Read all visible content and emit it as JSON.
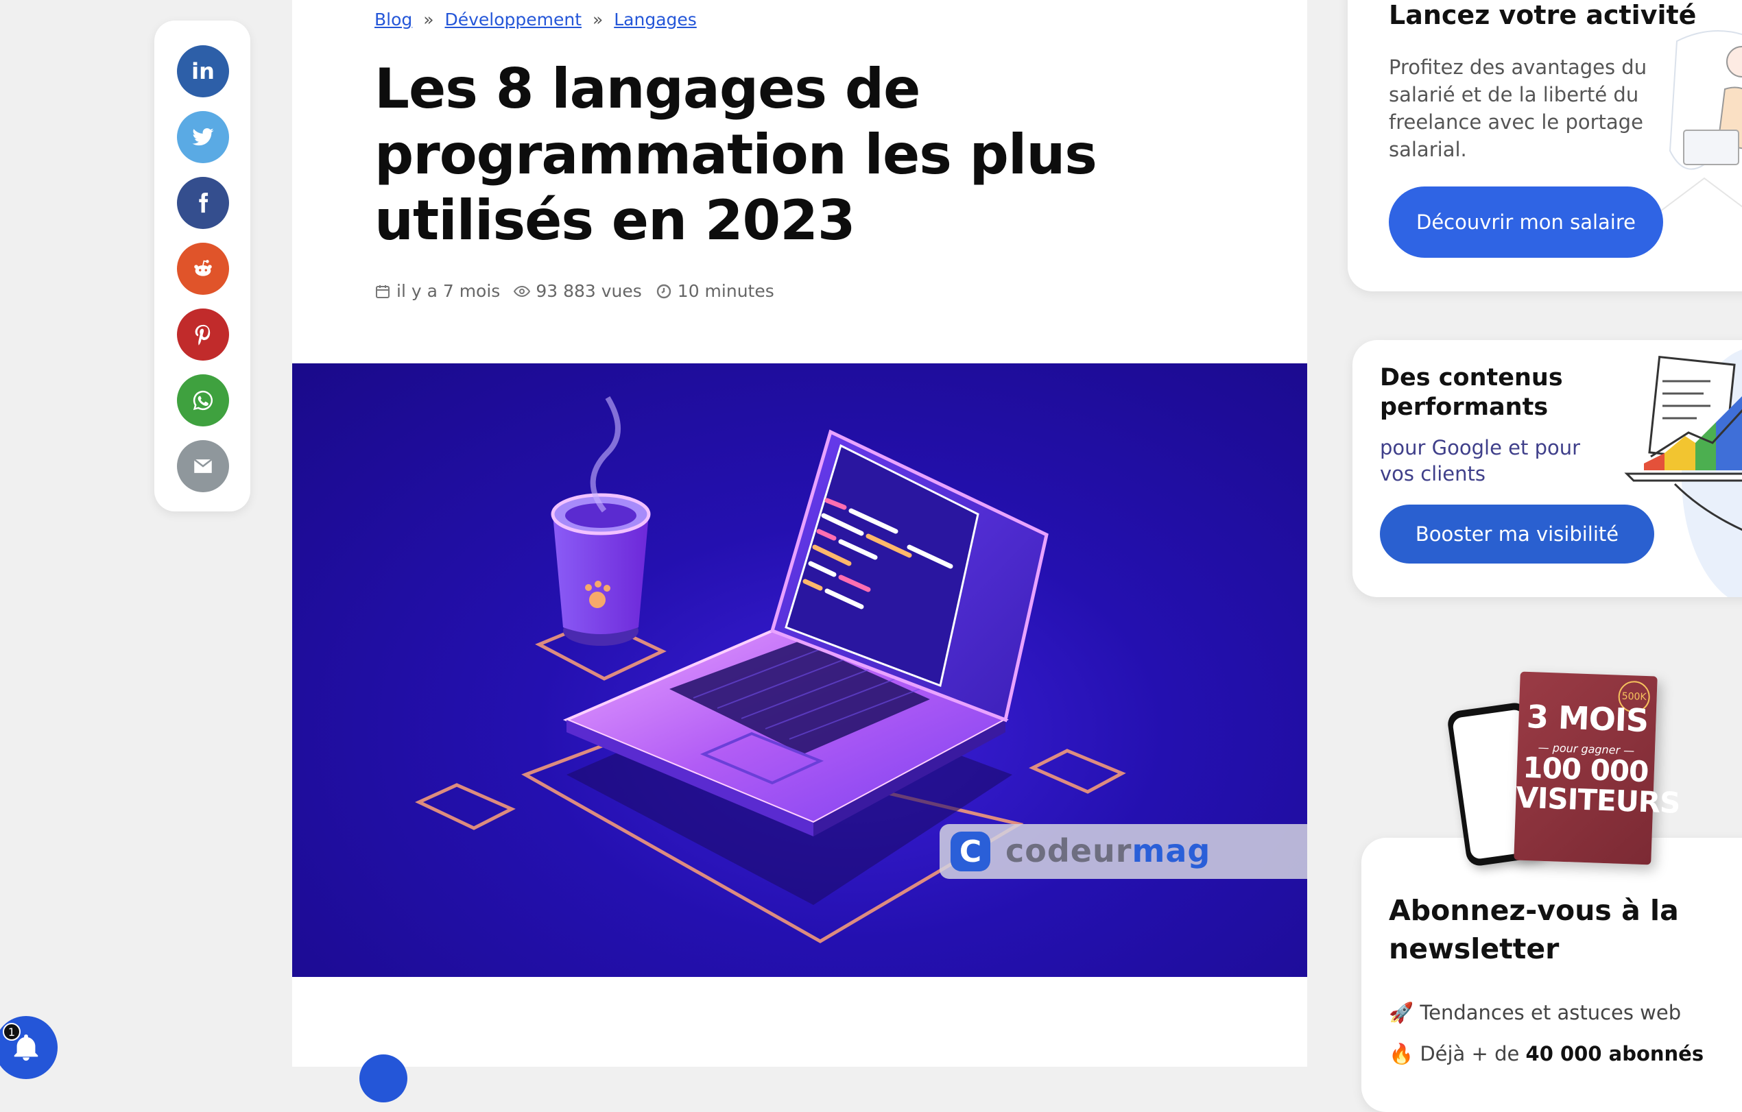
{
  "breadcrumb": {
    "items": [
      "Blog",
      "Développement",
      "Langages"
    ],
    "separator": "»"
  },
  "article": {
    "title": "Les 8 langages de programmation les plus utilisés en 2023",
    "meta": {
      "date": "il y a 7 mois",
      "views": "93 883 vues",
      "read_time": "10 minutes"
    },
    "hero": {
      "logo_letter": "C",
      "logo_word": "codeur",
      "logo_accent": "mag"
    }
  },
  "share": {
    "buttons": [
      {
        "name": "linkedin",
        "icon": "linkedin-icon",
        "color": "#2d5fa8"
      },
      {
        "name": "twitter",
        "icon": "twitter-icon",
        "color": "#5aaae4"
      },
      {
        "name": "facebook",
        "icon": "facebook-icon",
        "color": "#344e8e"
      },
      {
        "name": "reddit",
        "icon": "reddit-icon",
        "color": "#e0542a"
      },
      {
        "name": "pinterest",
        "icon": "pinterest-icon",
        "color": "#c12b2b"
      },
      {
        "name": "whatsapp",
        "icon": "whatsapp-icon",
        "color": "#3fa13f"
      },
      {
        "name": "email",
        "icon": "mail-icon",
        "color": "#8f979c"
      }
    ]
  },
  "sidebar": {
    "promo1": {
      "title": "Lancez votre activité",
      "text": "Profitez des avantages du salarié et de la liberté du freelance avec le portage salarial.",
      "button": "Découvrir mon salaire"
    },
    "promo2": {
      "title": "Des contenus performants",
      "text": "pour Google et pour vos clients",
      "button": "Booster ma visibilité"
    },
    "ebook": {
      "badge": "500K",
      "line1": "3 MOIS",
      "line2": "— pour gagner —",
      "line3": "100 000 VISITEURS"
    },
    "newsletter": {
      "title": "Abonnez-vous à la newsletter",
      "item1_emoji": "🚀",
      "item1": "Tendances et astuces web",
      "item2_emoji": "🔥",
      "item2_prefix": "Déjà + de ",
      "item2_bold": "40 000 abonnés"
    }
  },
  "notification": {
    "count": "1"
  },
  "colors": {
    "link": "#2456d8",
    "primary_button": "#2f64e4",
    "hero_bg": "#2410b0"
  }
}
